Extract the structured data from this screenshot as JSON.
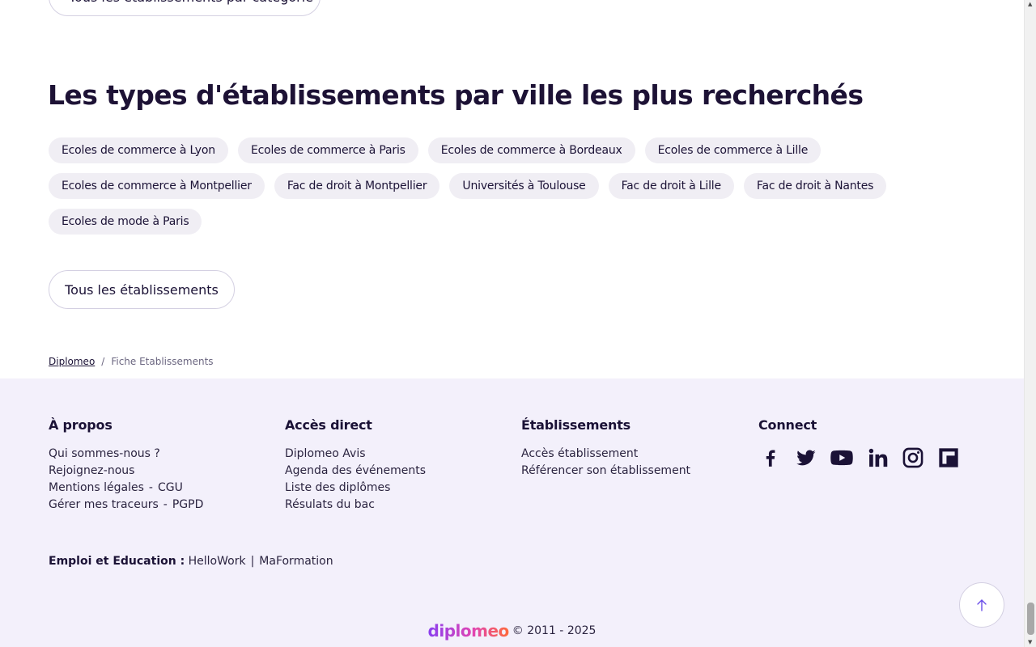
{
  "top_button_label": "Tous les établissements par catégorie",
  "section": {
    "title": "Les types d'établissements par ville les plus recherchés",
    "tag_rows": [
      [
        "Ecoles de commerce à Lyon",
        "Ecoles de commerce à Paris",
        "Ecoles de commerce à Bordeaux",
        "Ecoles de commerce à Lille"
      ],
      [
        "Ecoles de commerce à Montpellier",
        "Fac de droit à Montpellier",
        "Universités à Toulouse",
        "Fac de droit à Lille",
        "Fac de droit à Nantes"
      ],
      [
        "Ecoles de mode à Paris"
      ]
    ],
    "all_button_label": "Tous les établissements"
  },
  "breadcrumb": {
    "home": "Diplomeo",
    "separator": "/",
    "current": "Fiche Etablissements"
  },
  "footer": {
    "apropos": {
      "title": "À propos",
      "items": [
        "Qui sommes-nous ?",
        "Rejoignez-nous",
        "Mentions légales",
        "CGU",
        "Gérer mes traceurs",
        "PGPD"
      ],
      "separator": "-"
    },
    "acces": {
      "title": "Accès direct",
      "items": [
        "Diplomeo Avis",
        "Agenda des événements",
        "Liste des diplômes",
        "Résulats du bac"
      ]
    },
    "etablissements": {
      "title": "Établissements",
      "items": [
        "Accès établissement",
        "Référencer son établissement"
      ]
    },
    "connect": {
      "title": "Connect",
      "icons": [
        "facebook-icon",
        "twitter-icon",
        "youtube-icon",
        "linkedin-icon",
        "instagram-icon",
        "flipboard-icon"
      ]
    },
    "emploi": {
      "label": "Emploi et Education :",
      "links": [
        "HelloWork",
        "MaFormation"
      ],
      "separator": "|"
    },
    "logo_text": "diplomeo",
    "copyright": "© 2011 - 2025"
  },
  "colors": {
    "text": "#1b1236",
    "footer_bg": "#f3f0fb",
    "tag_bg": "#f0eef4",
    "accent": "#6a4ee8"
  }
}
